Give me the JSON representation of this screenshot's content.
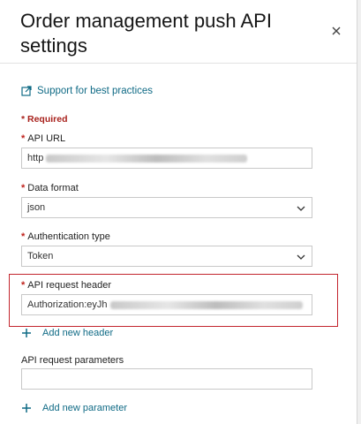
{
  "panel": {
    "title": "Order management push API settings",
    "close_icon": "close-icon"
  },
  "support": {
    "label": "Support for best practices",
    "icon": "external-link-icon"
  },
  "required_note": "* Required",
  "fields": {
    "api_url": {
      "label": "API URL",
      "value_prefix": "http"
    },
    "data_format": {
      "label": "Data format",
      "value": "json"
    },
    "auth_type": {
      "label": "Authentication type",
      "value": "Token"
    },
    "api_request_header": {
      "label": "API request header",
      "value_prefix": "Authorization:eyJh"
    },
    "api_request_parameters": {
      "label": "API request parameters",
      "value": ""
    }
  },
  "actions": {
    "add_header": "Add new header",
    "add_parameter": "Add new parameter"
  },
  "colors": {
    "link": "#0f6a85",
    "required": "#c0211b",
    "highlight_border": "#c3262e"
  }
}
